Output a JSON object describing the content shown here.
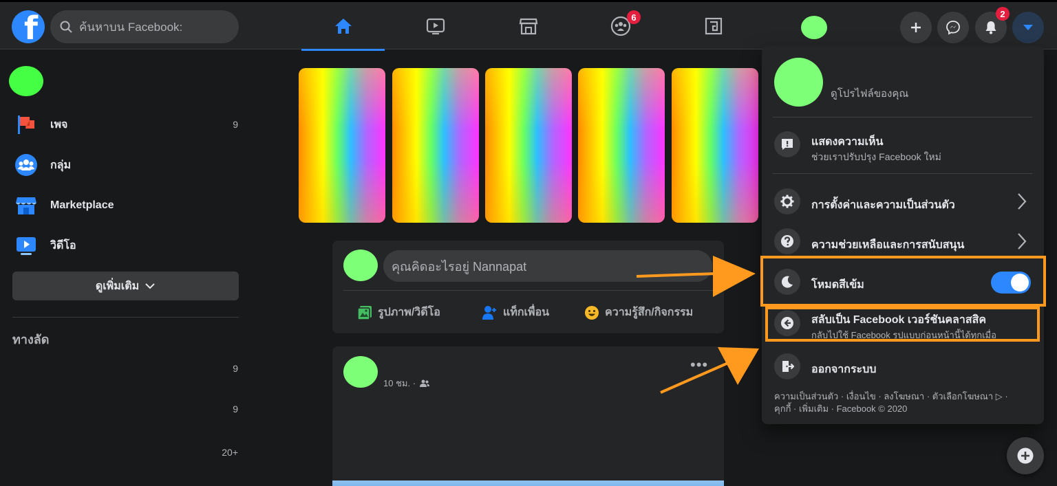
{
  "header": {
    "logo_letter": "f",
    "search_placeholder": "ค้นหาบน Facebook:",
    "nav": [
      {
        "name": "home",
        "active": true
      },
      {
        "name": "watch",
        "active": false
      },
      {
        "name": "marketplace",
        "active": false
      },
      {
        "name": "groups",
        "active": false,
        "badge": "6"
      },
      {
        "name": "gaming",
        "active": false
      }
    ],
    "notifications_badge": "2"
  },
  "sidebar": {
    "items": [
      {
        "label": "เพจ",
        "count": "9",
        "icon": "flag-icon"
      },
      {
        "label": "กลุ่ม",
        "count": "",
        "icon": "groups-icon"
      },
      {
        "label": "Marketplace",
        "count": "",
        "icon": "marketplace-icon"
      },
      {
        "label": "วิดีโอ",
        "count": "",
        "icon": "video-icon"
      }
    ],
    "see_more": "ดูเพิ่มเติม",
    "shortcuts_title": "ทางลัด",
    "shortcut_counts": [
      "9",
      "9",
      "20+"
    ]
  },
  "composer": {
    "placeholder": "คุณคิดอะไรอยู่ Nannapat",
    "actions": [
      {
        "label": "รูปภาพ/วิดีโอ",
        "icon": "photo-icon",
        "color": "#45bd62"
      },
      {
        "label": "แท็กเพื่อน",
        "icon": "tag-friends-icon",
        "color": "#1877f2"
      },
      {
        "label": "ความรู้สึก/กิจกรรม",
        "icon": "feeling-icon",
        "color": "#f7b928"
      }
    ]
  },
  "post": {
    "time": "10 ชม. ·",
    "more": "•••"
  },
  "menu": {
    "profile_label": "ดูโปรไฟล์ของคุณ",
    "feedback": {
      "title": "แสดงความเห็น",
      "subtitle": "ช่วยเราปรับปรุง Facebook ใหม่"
    },
    "settings": {
      "title": "การตั้งค่าและความเป็นส่วนตัว"
    },
    "help": {
      "title": "ความช่วยเหลือและการสนับสนุน"
    },
    "dark_mode": {
      "title": "โหมดสีเข้ม",
      "enabled": true
    },
    "classic": {
      "title": "สลับเป็น Facebook เวอร์ชันคลาสสิค",
      "subtitle": "กลับไปใช้ Facebook รูปแบบก่อนหน้านี้ได้ทุกเมื่อ"
    },
    "logout": {
      "title": "ออกจากระบบ"
    },
    "footer_line1": "ความเป็นส่วนตัว · เงื่อนไข · ลงโฆษณา · ตัวเลือกโฆษณา ▷ ·",
    "footer_line2": "คุกกี้ · เพิ่มเติม · Facebook © 2020"
  },
  "colors": {
    "accent": "#2d88ff",
    "highlight": "#ff9a1f",
    "badge": "#e41e3f",
    "placeholder_avatar": "#7dff78"
  }
}
